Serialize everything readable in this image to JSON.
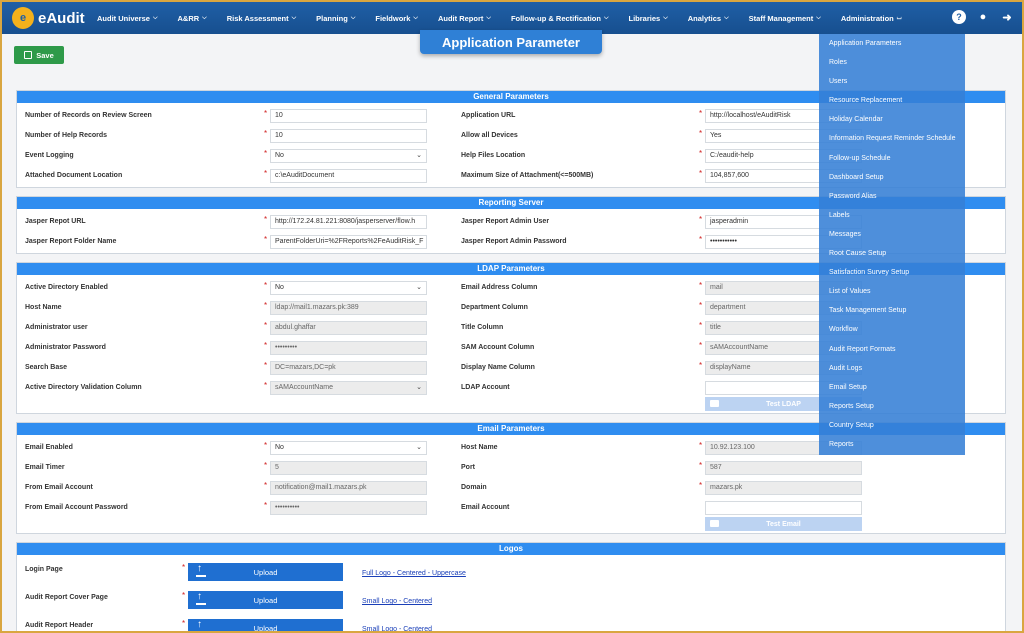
{
  "nav": {
    "brand": "eAudit",
    "brand_mark": "e",
    "items": [
      {
        "label": "Audit Universe"
      },
      {
        "label": "A&RR"
      },
      {
        "label": "Risk Assessment"
      },
      {
        "label": "Planning"
      },
      {
        "label": "Fieldwork"
      },
      {
        "label": "Audit Report"
      },
      {
        "label": "Follow-up & Rectification"
      },
      {
        "label": "Libraries"
      },
      {
        "label": "Analytics"
      },
      {
        "label": "Staff Management"
      },
      {
        "label": "Administration"
      }
    ],
    "icons": [
      "help-icon",
      "user-icon",
      "logout-icon"
    ]
  },
  "page": {
    "title": "Application Parameter",
    "save_label": "Save"
  },
  "general": {
    "header": "General Parameters",
    "left": [
      {
        "label": "Number of Records on Review Screen",
        "value": "10"
      },
      {
        "label": "Number of Help Records",
        "value": "10"
      },
      {
        "label": "Event Logging",
        "value": "No"
      },
      {
        "label": "Attached Document Location",
        "value": "c:\\eAuditDocument"
      }
    ],
    "right": [
      {
        "label": "Application URL",
        "value": "http://localhost/eAuditRisk"
      },
      {
        "label": "Allow all Devices",
        "value": "Yes"
      },
      {
        "label": "Help Files Location",
        "value": "C:/eaudit-help"
      },
      {
        "label": "Maximum Size of Attachment(<=500MB)",
        "value": "104,857,600"
      }
    ]
  },
  "reporting": {
    "header": "Reporting Server",
    "left": [
      {
        "label": "Jasper Repot URL",
        "value": "http://172.24.81.221:8080/jasperserver/flow.h"
      },
      {
        "label": "Jasper Report Folder Name",
        "value": "ParentFolderUri=%2FReports%2FeAuditRisk_F"
      }
    ],
    "right": [
      {
        "label": "Jasper Report Admin User",
        "value": "jasperadmin"
      },
      {
        "label": "Jasper Report Admin Password",
        "value": "•••••••••••"
      }
    ]
  },
  "ldap": {
    "header": "LDAP Parameters",
    "left": [
      {
        "label": "Active Directory Enabled",
        "value": "No"
      },
      {
        "label": "Host Name",
        "value": "ldap://mail1.mazars.pk:389"
      },
      {
        "label": "Administrator user",
        "value": "abdul.ghaffar"
      },
      {
        "label": "Administrator Password",
        "value": "•••••••••"
      },
      {
        "label": "Search Base",
        "value": "DC=mazars,DC=pk"
      },
      {
        "label": "Active Directory Validation Column",
        "value": "sAMAccountName"
      }
    ],
    "right": [
      {
        "label": "Email Address Column",
        "value": "mail"
      },
      {
        "label": "Department Column",
        "value": "department"
      },
      {
        "label": "Title Column",
        "value": "title"
      },
      {
        "label": "SAM Account Column",
        "value": "sAMAccountName"
      },
      {
        "label": "Display Name Column",
        "value": "displayName"
      },
      {
        "label": "LDAP Account",
        "value": ""
      }
    ],
    "test_label": "Test LDAP"
  },
  "email": {
    "header": "Email Parameters",
    "left": [
      {
        "label": "Email Enabled",
        "value": "No"
      },
      {
        "label": "Email Timer",
        "value": "5"
      },
      {
        "label": "From Email Account",
        "value": "notification@mail1.mazars.pk"
      },
      {
        "label": "From Email Account Password",
        "value": "••••••••••"
      }
    ],
    "right": [
      {
        "label": "Host Name",
        "value": "10.92.123.100"
      },
      {
        "label": "Port",
        "value": "587"
      },
      {
        "label": "Domain",
        "value": "mazars.pk"
      },
      {
        "label": "Email Account",
        "value": ""
      }
    ],
    "test_label": "Test Email"
  },
  "logos": {
    "header": "Logos",
    "upload_label": "Upload",
    "items": [
      {
        "label": "Login Page",
        "link": "Full Logo - Centered - Uppercase"
      },
      {
        "label": "Audit Report Cover Page",
        "link": "Small Logo - Centered"
      },
      {
        "label": "Audit Report Header",
        "link": "Small Logo - Centered"
      }
    ]
  },
  "admin_menu": [
    "Application Parameters",
    "Roles",
    "Users",
    "Resource Replacement",
    "Holiday Calendar",
    "Information Request Reminder Schedule",
    "Follow-up Schedule",
    "Dashboard Setup",
    "Password Alias",
    "Labels",
    "Messages",
    "Root Cause Setup",
    "Satisfaction Survey Setup",
    "List of Values",
    "Task Management Setup",
    "Workflow",
    "Audit Report Formats",
    "Audit Logs",
    "Email Setup",
    "Reports Setup",
    "Country Setup",
    "Reports"
  ]
}
